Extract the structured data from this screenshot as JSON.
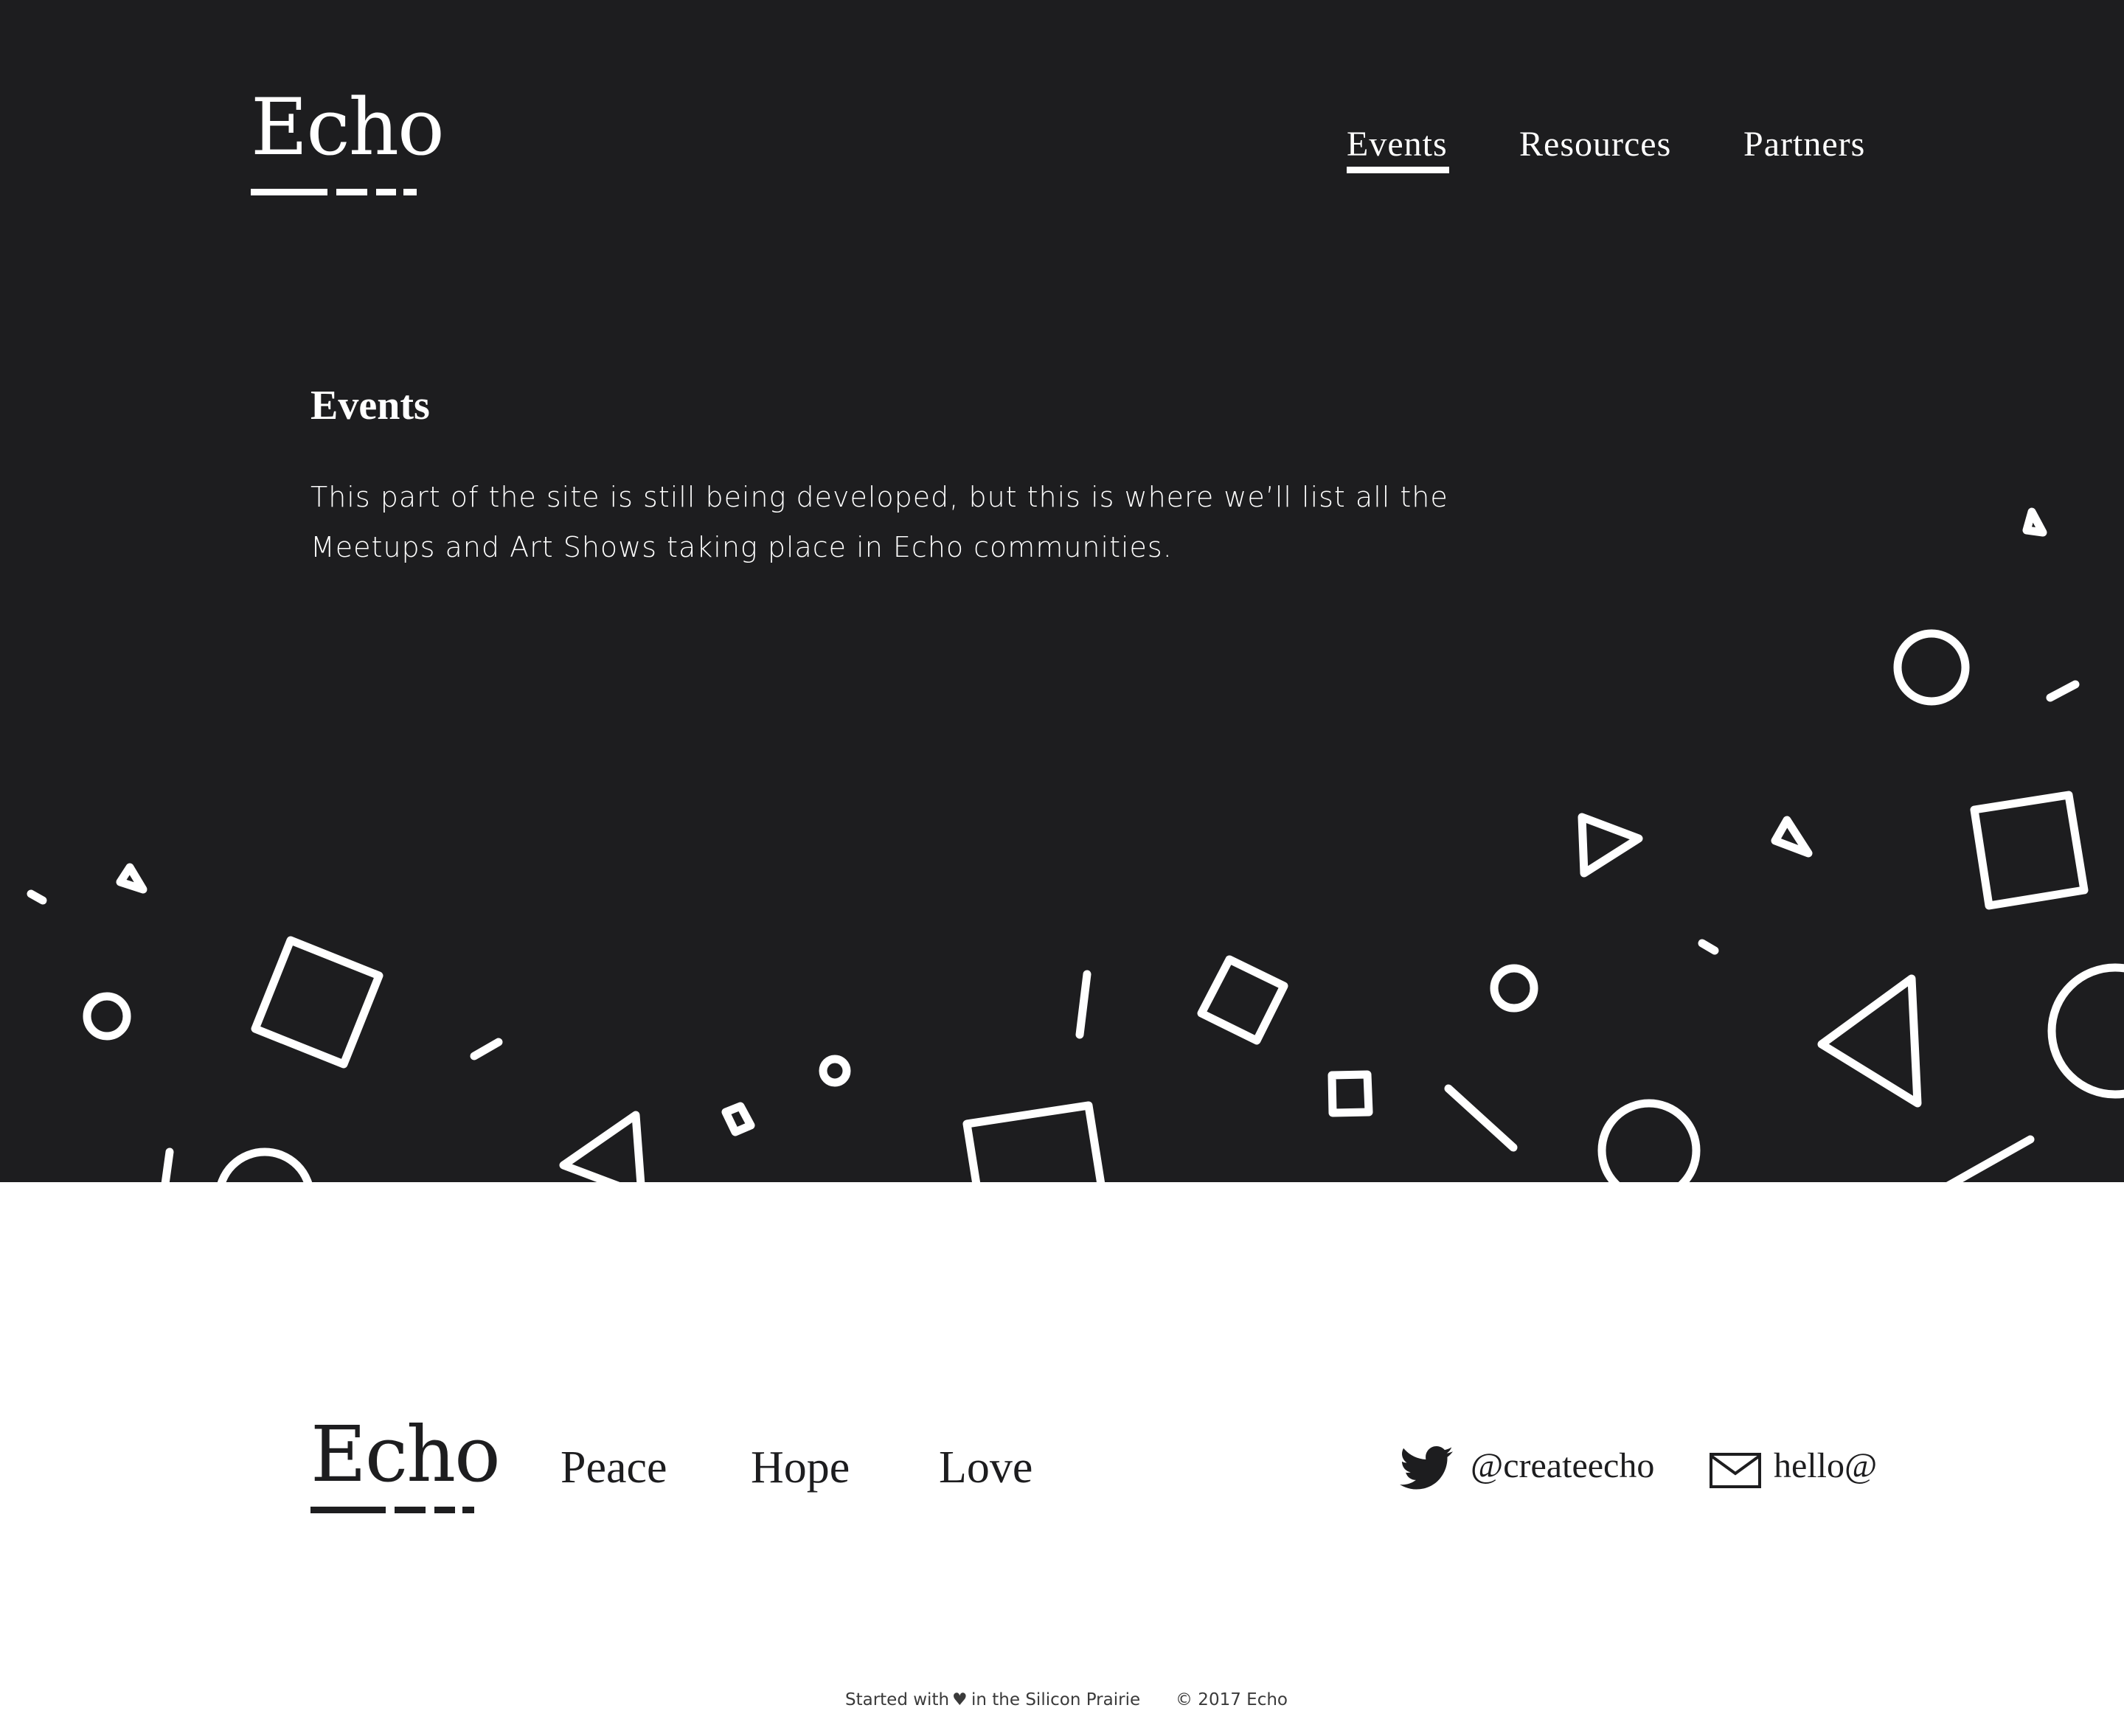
{
  "brand": {
    "name": "Echo"
  },
  "nav": {
    "items": [
      {
        "label": "Events",
        "active": true
      },
      {
        "label": "Resources",
        "active": false
      },
      {
        "label": "Partners",
        "active": false
      }
    ]
  },
  "main": {
    "heading": "Events",
    "intro": "This part of the site is still being developed, but this is where we’ll list all the Meetups and Art Shows taking place in Echo communities."
  },
  "footer": {
    "logo": "Echo",
    "values": [
      "Peace",
      "Hope",
      "Love"
    ],
    "twitter": {
      "handle": "@createecho",
      "icon": "twitter-icon"
    },
    "email": {
      "label": "hello@",
      "icon": "mail-icon"
    },
    "credit_prefix": "Started with",
    "credit_icon": "♥",
    "credit_suffix": "in the Silicon Prairie",
    "copyright": "© 2017 Echo"
  },
  "colors": {
    "dark": "#1d1d1f",
    "light": "#ffffff"
  }
}
